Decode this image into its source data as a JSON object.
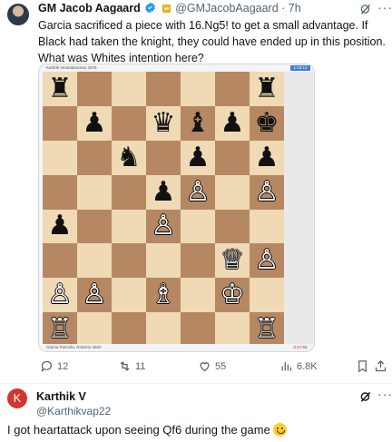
{
  "tweet": {
    "author_name": "GM Jacob Aagaard",
    "handle": "@GMJacobAagaard",
    "time": "· 7h",
    "text": "Garcia sacrificed a piece with 16.Ng5! to get a small advantage. If Black had taken the knight, they could have ended up in this position. What was Whites intention here?"
  },
  "board_image": {
    "top_player": "Karthik Venkataraman 2576",
    "top_clock": "1:18:12",
    "bottom_player": "Garcia Paricela, Roberto 2502",
    "bottom_clock": "0:47:56",
    "rows": [
      [
        "bR",
        "",
        "",
        "",
        "",
        "",
        "bR"
      ],
      [
        "",
        "bP",
        "",
        "bQ",
        "bB",
        "bP",
        "bK"
      ],
      [
        "",
        "",
        "bN",
        "",
        "bP",
        "",
        "bP"
      ],
      [
        "",
        "",
        "",
        "bP",
        "wP",
        "",
        "wP"
      ],
      [
        "bP",
        "",
        "",
        "wP",
        "",
        "",
        ""
      ],
      [
        "",
        "",
        "",
        "",
        "",
        "wQ",
        "wP"
      ],
      [
        "wP",
        "wP",
        "",
        "wB",
        "",
        "wK",
        ""
      ],
      [
        "wR",
        "",
        "",
        "",
        "",
        "",
        "wR"
      ]
    ],
    "pieces": {
      "wK": "♔",
      "wQ": "♕",
      "wR": "♖",
      "wB": "♗",
      "wN": "♘",
      "wP": "♙",
      "bK": "♚",
      "bQ": "♛",
      "bR": "♜",
      "bB": "♝",
      "bN": "♞",
      "bP": "♟"
    }
  },
  "actions": {
    "replies": "12",
    "reposts": "11",
    "likes": "55",
    "views": "6.8K"
  },
  "reply": {
    "avatar_letter": "K",
    "name": "Karthik V",
    "handle": "@Karthikvap22",
    "text": "I got heartattack  upon seeing Qf6 during the game"
  },
  "colors": {
    "light_square": "#f0d9b5",
    "dark_square": "#b58863",
    "verified": "#1d9bf0",
    "gold_badge": "#e2b719"
  }
}
